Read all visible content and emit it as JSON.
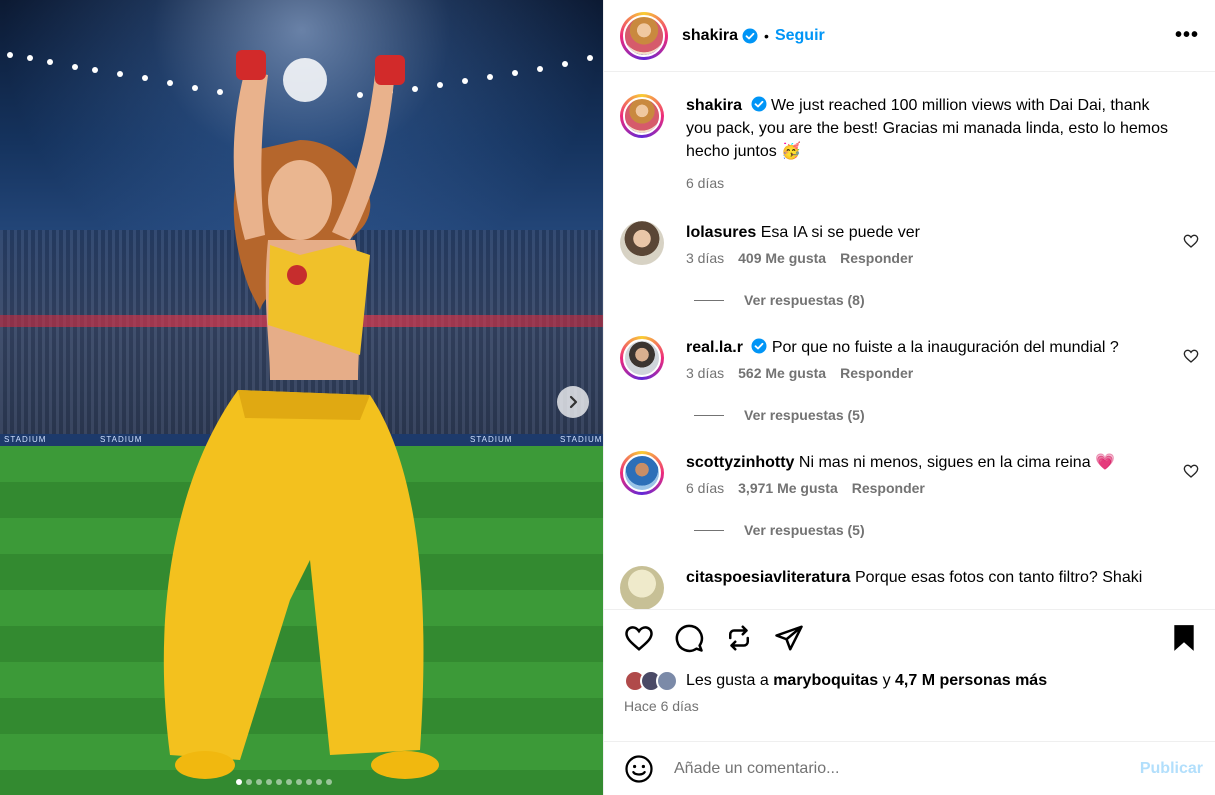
{
  "post": {
    "username": "shakira",
    "separator": "•",
    "follow_label": "Seguir",
    "more_label": "•••",
    "caption": {
      "username": "shakira",
      "text": "We just reached 100 million views with Dai Dai, thank you pack, you are the best! Gracias mi manada linda, esto lo hemos hecho juntos 🥳",
      "time": "6 días"
    },
    "media": {
      "ad_board_text": "STADIUM",
      "carousel_count": 10,
      "carousel_active": 1
    }
  },
  "comments": [
    {
      "username": "lolasures",
      "verified": false,
      "text": "Esa IA si se puede ver",
      "time": "3 días",
      "likes": "409 Me gusta",
      "reply": "Responder",
      "replies": "Ver respuestas (8)",
      "avatar_color": "#c9a98a"
    },
    {
      "username": "real.la.r",
      "verified": true,
      "text": "Por que no fuiste a la inauguración del mundial ?",
      "time": "3 días",
      "likes": "562 Me gusta",
      "reply": "Responder",
      "replies": "Ver respuestas (5)",
      "avatar_color": "#8a7f78"
    },
    {
      "username": "scottyzinhotty",
      "verified": false,
      "text": "Ni mas ni menos, sigues en la cima reina 💗",
      "time": "6 días",
      "likes": "3,971 Me gusta",
      "reply": "Responder",
      "replies": "Ver respuestas (5)",
      "avatar_color": "#3d7ac9"
    },
    {
      "username": "citaspoesiavliteratura",
      "verified": false,
      "text": "Porque esas fotos con tanto filtro? Shaki",
      "avatar_color": "#c8c39a"
    }
  ],
  "likes_summary": {
    "prefix": "Les gusta a",
    "user": "maryboquitas",
    "middle": "y",
    "count": "4,7 M personas más"
  },
  "post_time": "Hace 6 días",
  "add_comment": {
    "placeholder": "Añade un comentario...",
    "publish_label": "Publicar"
  },
  "colors": {
    "accent": "#0095f6",
    "publish_disabled": "#b2dffc",
    "muted": "#737373"
  }
}
